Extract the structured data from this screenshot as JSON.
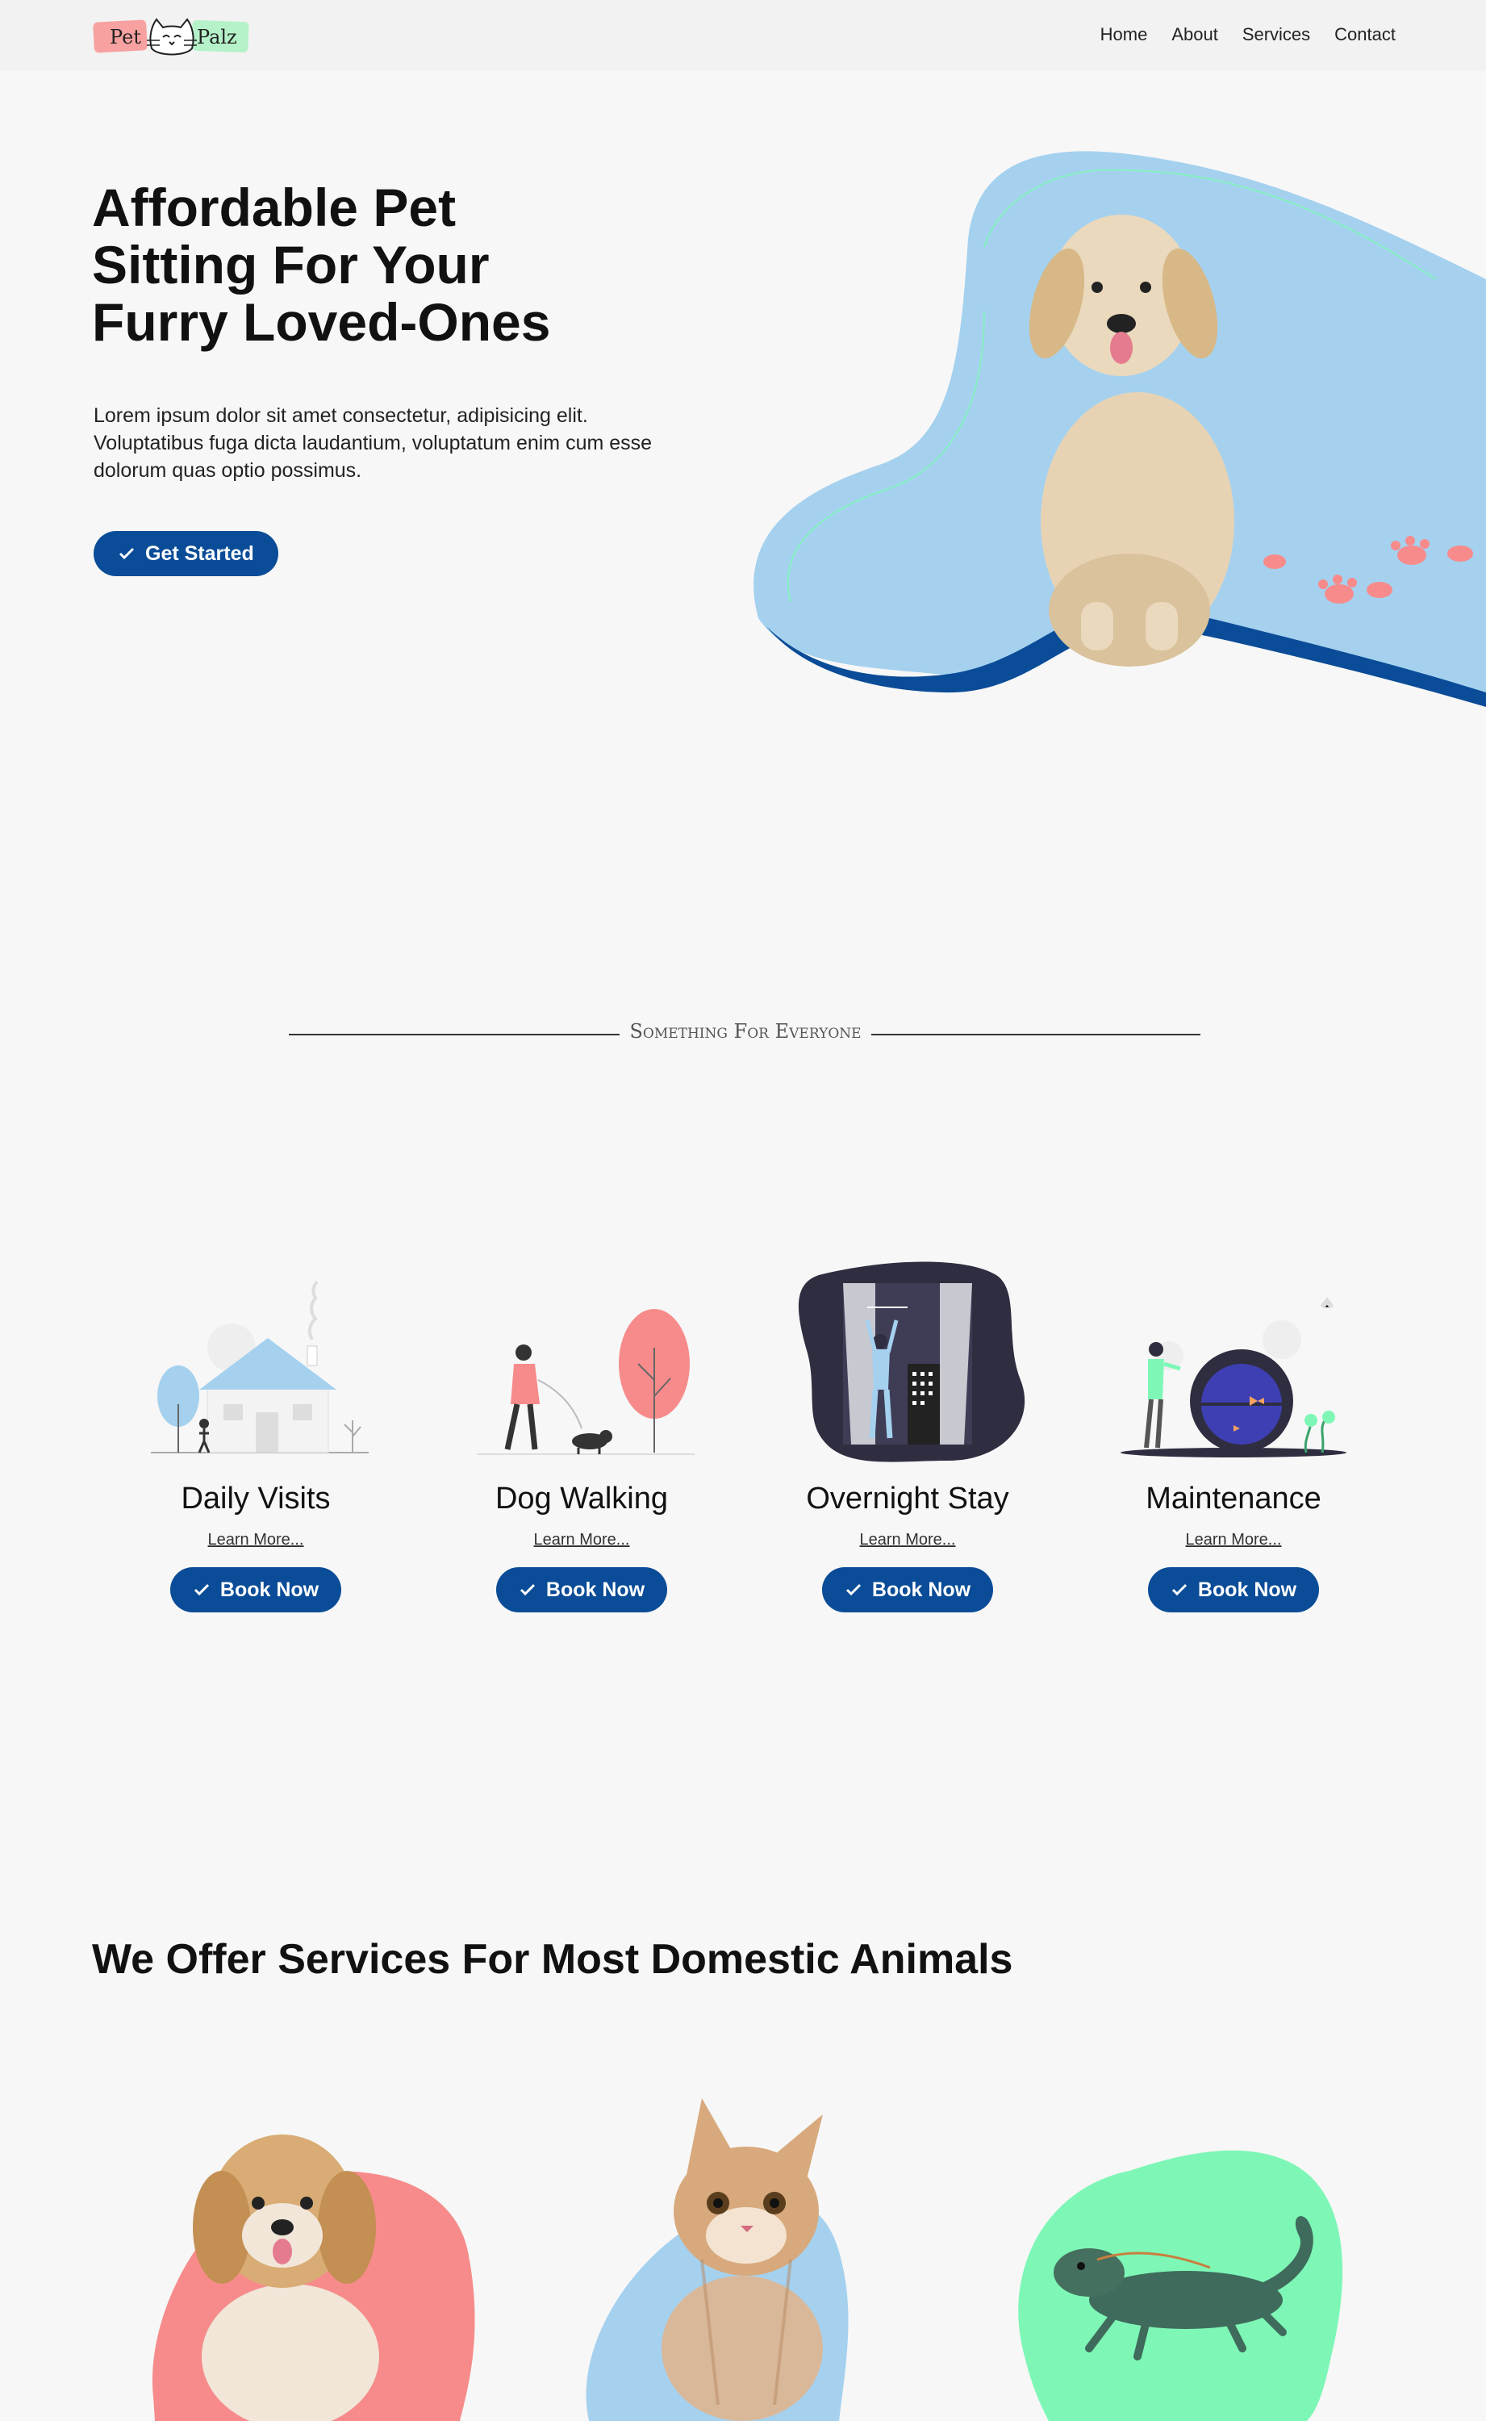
{
  "header": {
    "logo": {
      "left": "Pet",
      "right": "Palz"
    },
    "nav": [
      "Home",
      "About",
      "Services",
      "Contact"
    ]
  },
  "hero": {
    "title_lines": [
      "Affordable Pet",
      "Sitting For Your",
      "Furry Loved-Ones"
    ],
    "text": "Lorem ipsum dolor sit amet consectetur, adipisicing elit. Voluptatibus fuga dicta laudantium, voluptatum enim cum esse dolorum quas optio possimus.",
    "cta": "Get Started"
  },
  "divider": {
    "text": "Something For Everyone"
  },
  "services": [
    {
      "name": "Daily Visits",
      "link": "Learn More...",
      "button": "Book Now"
    },
    {
      "name": "Dog Walking",
      "link": "Learn More...",
      "button": "Book Now"
    },
    {
      "name": "Overnight Stay",
      "link": "Learn More...",
      "button": "Book Now"
    },
    {
      "name": "Maintenance",
      "link": "Learn More...",
      "button": "Book Now"
    }
  ],
  "animals": {
    "title": "We Offer Services For Most Domestic Animals"
  },
  "colors": {
    "brand_blue": "#0a4c97",
    "light_blue": "#a5d1ef",
    "pink": "#f78b8b",
    "mint": "#7ef7b6",
    "bg": "#f7f7f7"
  }
}
